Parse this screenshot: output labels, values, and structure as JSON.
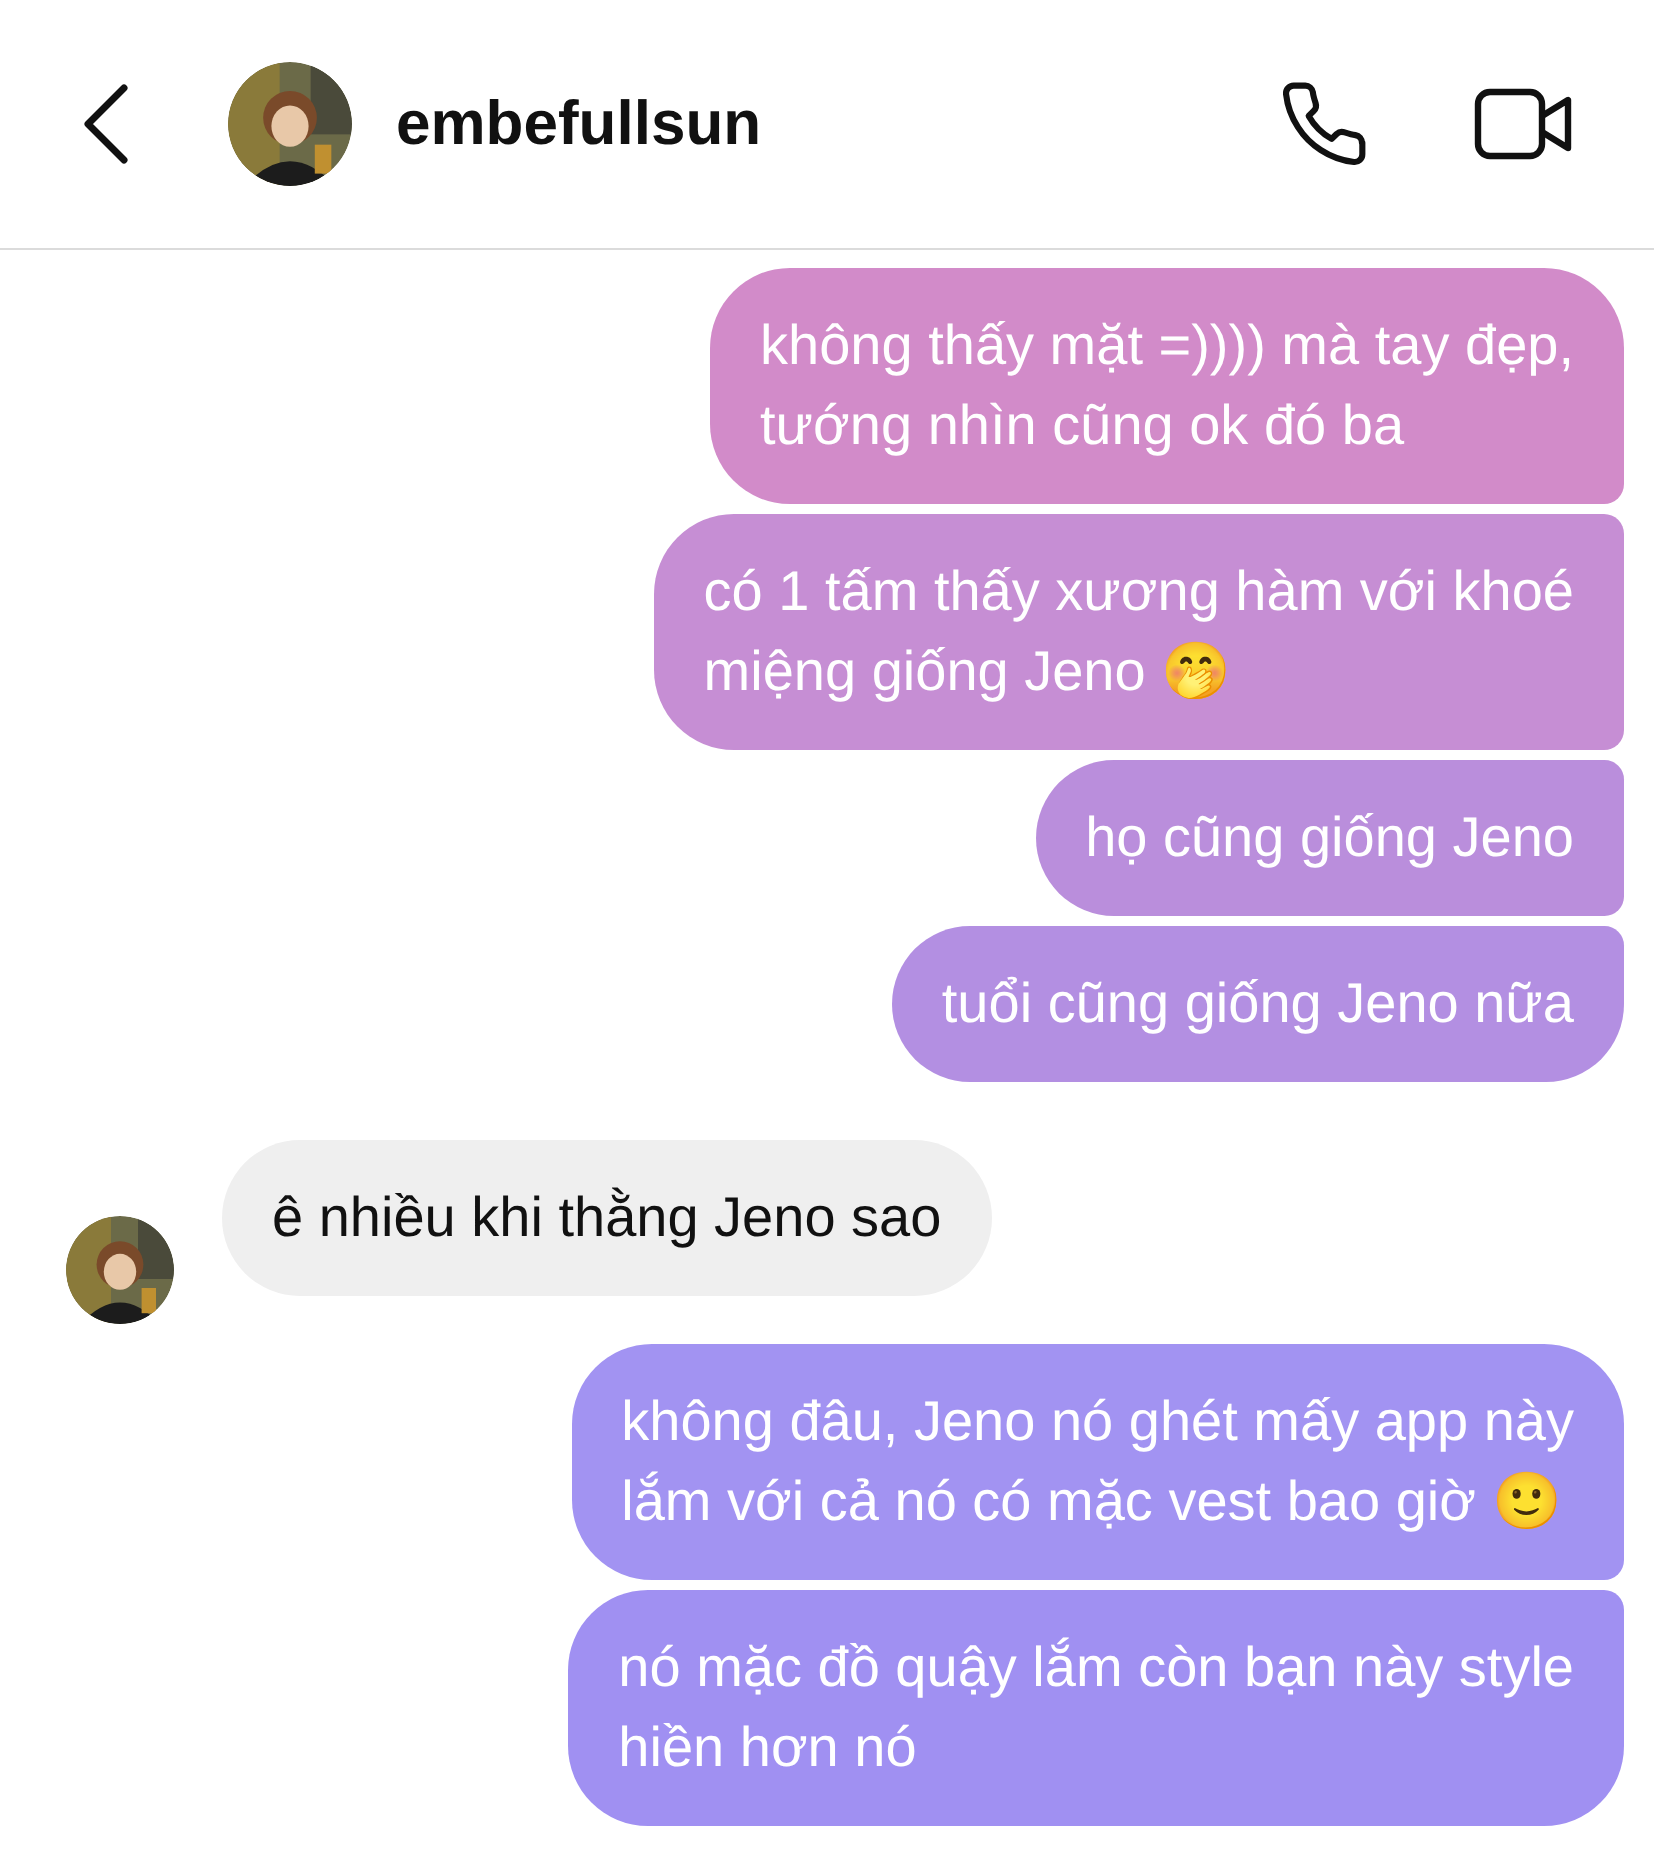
{
  "header": {
    "username": "embefullsun"
  },
  "messages": [
    {
      "kind": "sent",
      "lines": [
        "không thấy mặt =)))) mà tay đẹp,",
        "tướng nhìn cũng ok đó ba"
      ]
    },
    {
      "kind": "sent",
      "lines": [
        "có 1 tấm thấy xương hàm với khoé",
        "miệng giống Jeno 🤭"
      ]
    },
    {
      "kind": "sent",
      "lines": [
        "họ cũng giống Jeno"
      ]
    },
    {
      "kind": "sent",
      "lines": [
        "tuổi cũng giống Jeno nữa"
      ]
    },
    {
      "kind": "received",
      "lines": [
        "ê nhiều khi thằng Jeno sao"
      ]
    },
    {
      "kind": "sent",
      "lines": [
        "không đâu, Jeno nó ghét mấy app này",
        "lắm với cả nó có mặc vest bao giờ 🙂"
      ]
    },
    {
      "kind": "sent",
      "lines": [
        "nó mặc đồ quậy lắm còn bạn này style",
        "hiền hơn nó"
      ]
    }
  ]
}
